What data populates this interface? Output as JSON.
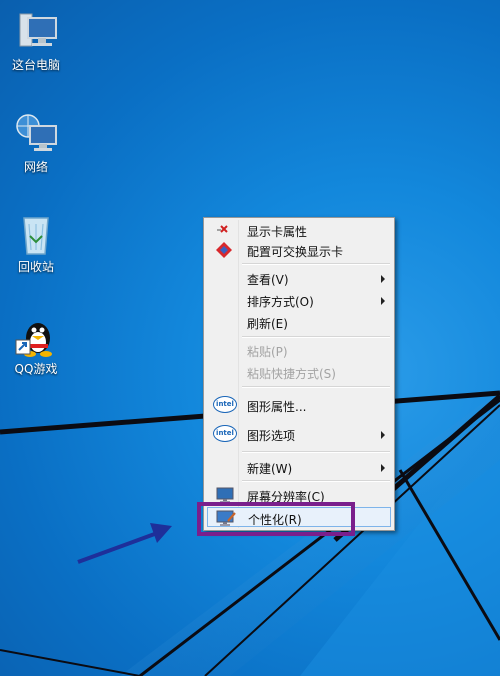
{
  "desktop": {
    "icons": [
      {
        "label": "这台电脑",
        "icon": "this-pc-icon"
      },
      {
        "label": "网络",
        "icon": "network-icon"
      },
      {
        "label": "回收站",
        "icon": "recycle-bin-icon"
      },
      {
        "label": "QQ游戏",
        "icon": "qq-game-icon"
      }
    ]
  },
  "context_menu": {
    "items": [
      {
        "label": "显示卡属性",
        "icon": "graphics-properties-icon",
        "enabled": true
      },
      {
        "label": "配置可交换显示卡",
        "icon": "switchable-graphics-icon",
        "enabled": true
      },
      {
        "label": "查看(V)",
        "submenu": true,
        "enabled": true
      },
      {
        "label": "排序方式(O)",
        "submenu": true,
        "enabled": true
      },
      {
        "label": "刷新(E)",
        "enabled": true
      },
      {
        "label": "粘贴(P)",
        "enabled": false
      },
      {
        "label": "粘贴快捷方式(S)",
        "enabled": false
      },
      {
        "label": "图形属性...",
        "icon": "intel-icon",
        "enabled": true
      },
      {
        "label": "图形选项",
        "icon": "intel-icon",
        "submenu": true,
        "enabled": true
      },
      {
        "label": "新建(W)",
        "submenu": true,
        "enabled": true
      },
      {
        "label": "屏幕分辨率(C)",
        "icon": "screen-resolution-icon",
        "enabled": true
      },
      {
        "label": "个性化(R)",
        "icon": "personalize-icon",
        "enabled": true,
        "highlighted": true
      }
    ],
    "intel_text": "intel"
  },
  "annotation": {
    "highlight_color": "#7a1f8c",
    "arrow_color": "#1e2f9a"
  }
}
